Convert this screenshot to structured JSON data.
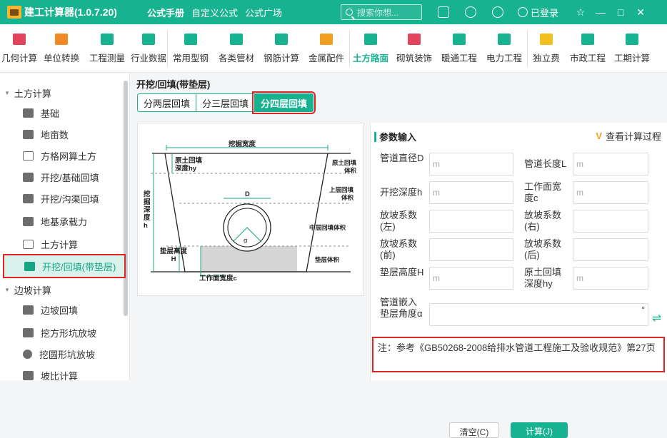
{
  "titlebar": {
    "app_title": "建工计算器(1.0.7.20)",
    "tabs": [
      "公式手册",
      "自定义公式",
      "公式广场"
    ],
    "search_placeholder": "搜索你想...",
    "login_text": "已登录",
    "accent": "#17b290"
  },
  "toolbar": {
    "items": [
      {
        "label": "几何计算",
        "icon": "cube-icon",
        "color": "#e2445c"
      },
      {
        "label": "单位转换",
        "icon": "cm-icon",
        "color": "#f08a24"
      },
      {
        "label": "工程测量",
        "icon": "axis-icon",
        "color": "#17b290"
      },
      {
        "label": "行业数据",
        "icon": "chart-icon",
        "color": "#17b290"
      },
      {
        "label": "常用型钢",
        "icon": "tools-icon",
        "color": "#17b290"
      },
      {
        "label": "各类管材",
        "icon": "pipe-icon",
        "color": "#17b290"
      },
      {
        "label": "钢筋计算",
        "icon": "rebar-icon",
        "color": "#17b290"
      },
      {
        "label": "金属配件",
        "icon": "fitting-icon",
        "color": "#f0a020"
      },
      {
        "label": "土方路面",
        "icon": "road-icon",
        "color": "#17b290"
      },
      {
        "label": "砌筑装饰",
        "icon": "brick-icon",
        "color": "#e2445c"
      },
      {
        "label": "暖通工程",
        "icon": "fan-icon",
        "color": "#17b290"
      },
      {
        "label": "电力工程",
        "icon": "house-power-icon",
        "color": "#17b290"
      },
      {
        "label": "独立费",
        "icon": "fee-icon",
        "color": "#f0c020"
      },
      {
        "label": "市政工程",
        "icon": "municipal-icon",
        "color": "#17b290"
      },
      {
        "label": "工期计算",
        "icon": "truck-icon",
        "color": "#17b290"
      }
    ],
    "active_index": 8
  },
  "sidebar": {
    "group1": "土方计算",
    "items": [
      "基础",
      "地亩数",
      "方格网算土方",
      "开挖/基础回填",
      "开挖/沟渠回填",
      "地基承载力",
      "土方计算",
      "开挖/回填(带垫层)"
    ],
    "selected_index": 7,
    "group2": "边坡计算",
    "items2": [
      "边坡回填",
      "挖方形坑放坡",
      "挖圆形坑放坡",
      "坡比计算"
    ]
  },
  "main": {
    "title": "开挖/回填(带垫层)",
    "subtabs": [
      "分两层回填",
      "分三层回填",
      "分四层回填"
    ],
    "active_subtab": 2,
    "diagram": {
      "top_width": "挖掘宽度",
      "orig_backfill_depth": "原土回填\n深度hy",
      "orig_backfill_volume": "原土回填\n体积",
      "pipe_d": "D",
      "upper_backfill": "上层回填\n体积",
      "dig_depth": "挖\n掘\n深\n度\nh",
      "alpha": "α",
      "middle_backfill": "中层回填体积",
      "cushion_height": "垫层高度\nH",
      "cushion_volume": "垫层体积",
      "work_width": "工作面宽度c"
    }
  },
  "params": {
    "header": "参数输入",
    "view_calc": "查看计算过程",
    "fields": [
      {
        "label": "管道直径D",
        "placeholder": "m"
      },
      {
        "label": "管道长度L",
        "placeholder": "m"
      },
      {
        "label": "开挖深度h",
        "placeholder": "m"
      },
      {
        "label": "工作面宽度c",
        "placeholder": "m"
      },
      {
        "label": "放坡系数(左)",
        "placeholder": ""
      },
      {
        "label": "放坡系数(右)",
        "placeholder": ""
      },
      {
        "label": "放坡系数(前)",
        "placeholder": ""
      },
      {
        "label": "放坡系数(后)",
        "placeholder": ""
      },
      {
        "label": "垫层高度H",
        "placeholder": "m"
      },
      {
        "label": "原土回填深度hy",
        "placeholder": "m"
      },
      {
        "label": "管道嵌入垫层角度α",
        "placeholder": ""
      }
    ],
    "degree_unit": "°",
    "note": "注：参考《GB50268-2008给排水管道工程施工及验收规范》第27页",
    "clear_label": "清空(C)",
    "calc_label": "计算(J)"
  }
}
